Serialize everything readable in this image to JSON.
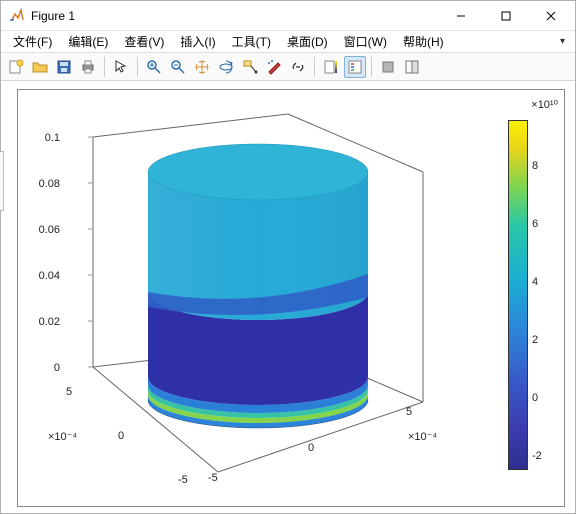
{
  "window": {
    "title": "Figure 1"
  },
  "menu": {
    "file": "文件(F)",
    "edit": "编辑(E)",
    "view": "查看(V)",
    "insert": "插入(I)",
    "tools": "工具(T)",
    "desktop": "桌面(D)",
    "window_m": "窗口(W)",
    "help": "帮助(H)"
  },
  "toolbar_icons": {
    "new": "new-figure",
    "open": "open",
    "save": "save",
    "print": "print",
    "pointer": "pointer",
    "zoomin": "zoom-in",
    "zoomout": "zoom-out",
    "pan": "pan",
    "rotate": "rotate3d",
    "datacursor": "data-cursor",
    "brush": "brush",
    "link": "link",
    "colorbar": "insert-colorbar",
    "legend": "insert-legend",
    "hide": "hide-tools",
    "dock": "dock"
  },
  "chart_data": {
    "type": "surface3d",
    "description": "3D colored cylinder surface plot with colorbar",
    "x_range": [
      -0.0005,
      0.0005
    ],
    "y_range": [
      -0.0005,
      0.0005
    ],
    "z_range": [
      0,
      0.1
    ],
    "x_exponent": "×10^{-4}",
    "y_exponent": "×10^{-4}",
    "x_ticks": [
      -5,
      0,
      5
    ],
    "y_ticks": [
      -5,
      0,
      5
    ],
    "z_ticks": [
      0,
      0.02,
      0.04,
      0.06,
      0.08,
      0.1
    ],
    "colorbar": {
      "exponent": "×10^{10}",
      "ticks": [
        -2,
        0,
        2,
        4,
        6,
        8
      ],
      "range": [
        -30000000000.0,
        90000000000.0
      ]
    },
    "cylinder": {
      "radius": 0.0005,
      "height": 0.1,
      "bands_value_approx": [
        {
          "z_from": 0.0,
          "z_to": 0.005,
          "c": 40000000000.0
        },
        {
          "z_from": 0.005,
          "z_to": 0.01,
          "c": -10000000000.0
        },
        {
          "z_from": 0.01,
          "z_to": 0.045,
          "c": -25000000000.0
        },
        {
          "z_from": 0.045,
          "z_to": 0.1,
          "c": 20000000000.0
        }
      ],
      "top_cap_c": 22000000000.0
    }
  },
  "axis_labels": {
    "z": [
      "0",
      "0.02",
      "0.04",
      "0.06",
      "0.08",
      "0.1"
    ],
    "x": [
      "-5",
      "0",
      "5"
    ],
    "y": [
      "-5",
      "0",
      "5"
    ],
    "x_exp": "×10⁻⁴",
    "y_exp": "×10⁻⁴"
  },
  "cb_labels": [
    "-2",
    "0",
    "2",
    "4",
    "6",
    "8"
  ],
  "cb_exp": "×10¹⁰"
}
